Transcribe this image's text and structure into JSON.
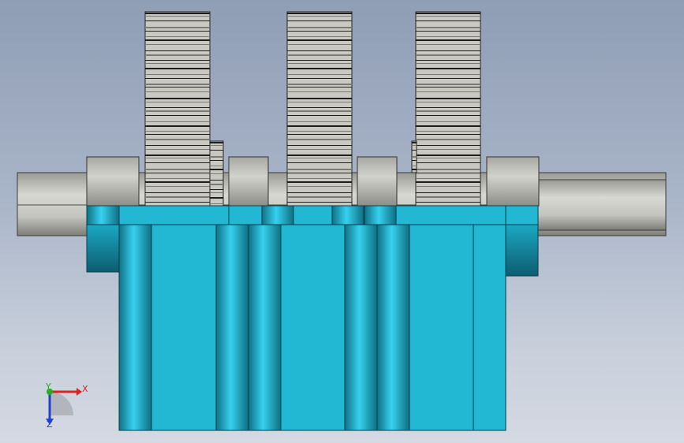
{
  "viewport": {
    "background_top": "#8f9db5",
    "background_bottom": "#d4d9e2"
  },
  "model": {
    "shaft_color": "#c6c6c0",
    "gear_color": "#c9c9c1",
    "housing_color": "#22b7d3",
    "housing_dark": "#0f6f83",
    "gear_count": 3,
    "housing_sections": 3
  },
  "triad": {
    "x_label": "X",
    "y_label": "Y",
    "z_label": "Z",
    "x_color": "#e02020",
    "y_color": "#20b020",
    "z_color": "#2040d0"
  }
}
